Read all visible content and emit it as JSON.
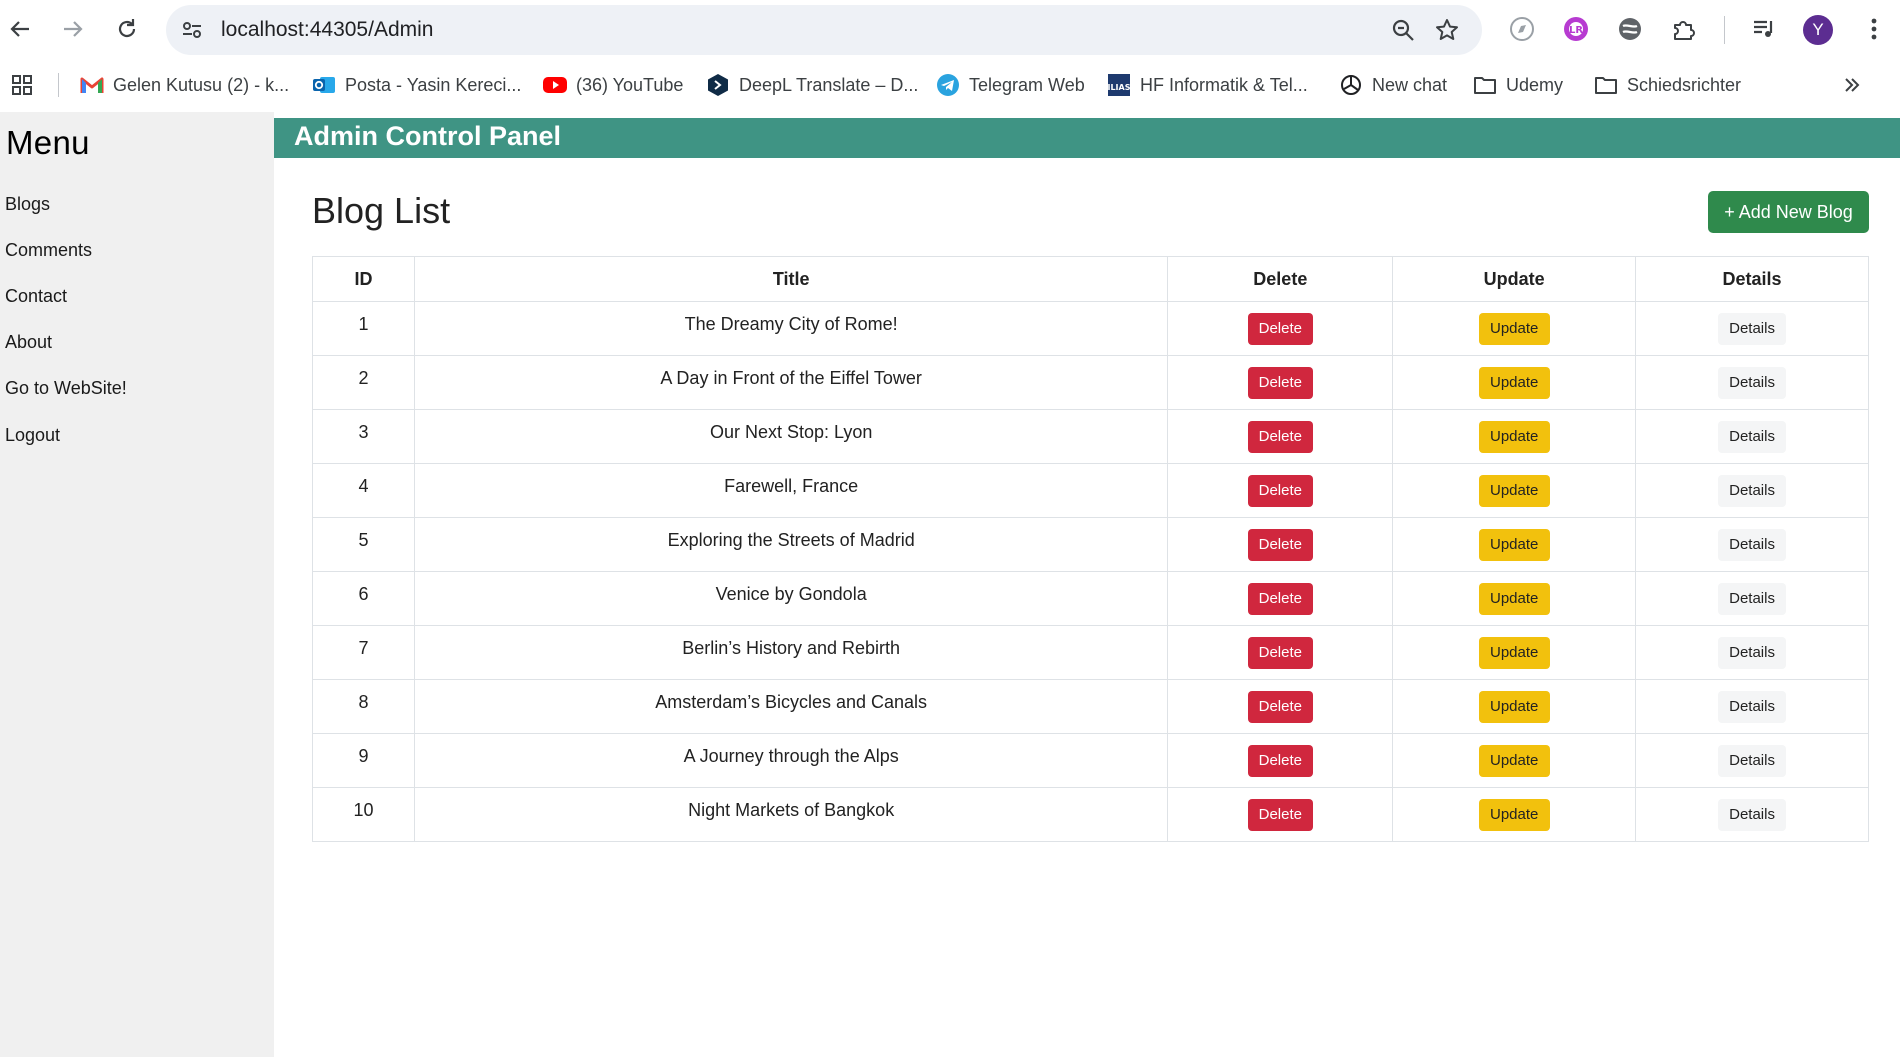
{
  "browser": {
    "url": "localhost:44305/Admin",
    "profile_initial": "Y",
    "bookmarks": [
      {
        "label": "Gelen Kutusu (2) - k...",
        "icon": "gmail-icon"
      },
      {
        "label": "Posta - Yasin Kereci...",
        "icon": "outlook-icon"
      },
      {
        "label": "(36) YouTube",
        "icon": "youtube-icon"
      },
      {
        "label": "DeepL Translate – D...",
        "icon": "deepl-icon"
      },
      {
        "label": "Telegram Web",
        "icon": "telegram-icon"
      },
      {
        "label": "HF Informatik & Tel...",
        "icon": "ilias-icon"
      },
      {
        "label": "New chat",
        "icon": "openai-icon"
      },
      {
        "label": "Udemy",
        "icon": "folder-icon"
      },
      {
        "label": "Schiedsrichter",
        "icon": "folder-icon"
      }
    ]
  },
  "sidebar": {
    "title": "Menu",
    "items": [
      "Blogs",
      "Comments",
      "Contact",
      "About",
      "Go to WebSite!",
      "Logout"
    ]
  },
  "header": {
    "title": "Admin Control Panel"
  },
  "main": {
    "title": "Blog List",
    "add_button": "+ Add New Blog",
    "columns": [
      "ID",
      "Title",
      "Delete",
      "Update",
      "Details"
    ],
    "rows": [
      {
        "id": "1",
        "title": "The Dreamy City of Rome!"
      },
      {
        "id": "2",
        "title": "A Day in Front of the Eiffel Tower"
      },
      {
        "id": "3",
        "title": "Our Next Stop: Lyon"
      },
      {
        "id": "4",
        "title": "Farewell, France"
      },
      {
        "id": "5",
        "title": "Exploring the Streets of Madrid"
      },
      {
        "id": "6",
        "title": "Venice by Gondola"
      },
      {
        "id": "7",
        "title": "Berlin’s History and Rebirth"
      },
      {
        "id": "8",
        "title": "Amsterdam’s Bicycles and Canals"
      },
      {
        "id": "9",
        "title": "A Journey through the Alps"
      },
      {
        "id": "10",
        "title": "Night Markets of Bangkok"
      }
    ],
    "delete_label": "Delete",
    "update_label": "Update",
    "details_label": "Details"
  },
  "colors": {
    "header_bg": "#3f9484",
    "add_button": "#2f8a4c",
    "delete_button": "#d0273e",
    "update_button": "#f2c10d",
    "details_button": "#f4f5f6",
    "sidebar_bg": "#f0f0f0"
  }
}
